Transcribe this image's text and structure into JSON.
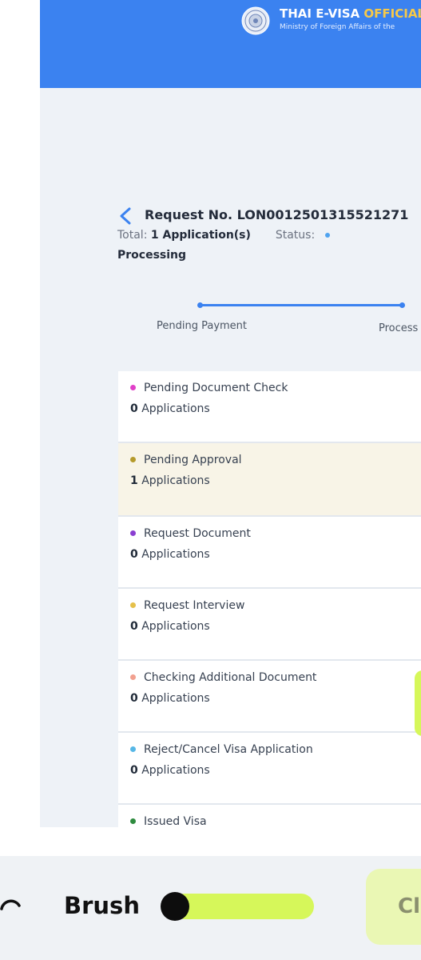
{
  "header": {
    "title_main": "THAI E-VISA ",
    "title_accent": "OFFICIAL",
    "subtitle": "Ministry of Foreign Affairs of the"
  },
  "request": {
    "title": "Request No. LON0012501315521271",
    "total_label": "Total:",
    "total_value": "1 Application(s)",
    "status_label": "Status:",
    "status_value": "Processing"
  },
  "progress": {
    "steps": [
      {
        "label": "Pending Payment"
      },
      {
        "label": "Process"
      }
    ]
  },
  "status_cards": [
    {
      "label": "Pending Document Check",
      "count": "0",
      "unit": "Applications",
      "dot_color": "#e040c8"
    },
    {
      "label": "Pending Approval",
      "count": "1",
      "unit": "Applications",
      "dot_color": "#b59a2b"
    },
    {
      "label": "Request Document",
      "count": "0",
      "unit": "Applications",
      "dot_color": "#8a3fd1"
    },
    {
      "label": "Request Interview",
      "count": "0",
      "unit": "Applications",
      "dot_color": "#e5c04a"
    },
    {
      "label": "Checking Additional Document",
      "count": "0",
      "unit": "Applications",
      "dot_color": "#f2a08f"
    },
    {
      "label": "Reject/Cancel Visa Application",
      "count": "0",
      "unit": "Applications",
      "dot_color": "#56b7e6"
    },
    {
      "label": "Issued Visa",
      "dot_color": "#2e8b3e"
    }
  ],
  "toolbar": {
    "brush_label": "Brush",
    "clear_label": "Cl",
    "brush_size_fraction": 0.1,
    "accent": "#d6f75a"
  },
  "icons": {
    "emblem": "emblem-icon",
    "back": "chevron-left-icon",
    "undo": "undo-icon"
  },
  "colors": {
    "header_blue": "#3b82f0",
    "highlight_row": "#f8f4e7"
  }
}
